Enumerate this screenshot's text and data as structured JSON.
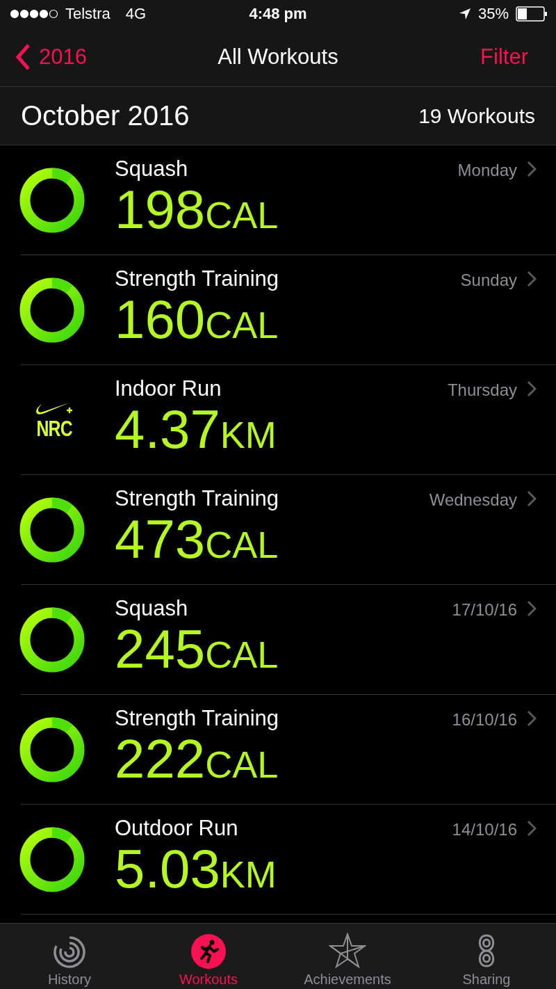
{
  "status_bar": {
    "carrier": "Telstra",
    "network": "4G",
    "time": "4:48 pm",
    "battery": "35%"
  },
  "nav": {
    "back": "2016",
    "title": "All Workouts",
    "action": "Filter"
  },
  "section": {
    "title": "October 2016",
    "count": "19 Workouts"
  },
  "workouts": [
    {
      "kind": "ring",
      "name": "Squash",
      "value": "198",
      "unit": "CAL",
      "date": "Monday"
    },
    {
      "kind": "ring",
      "name": "Strength Training",
      "value": "160",
      "unit": "CAL",
      "date": "Sunday"
    },
    {
      "kind": "nrc",
      "logo_text": "NRC",
      "name": "Indoor Run",
      "value": "4.37",
      "unit": "KM",
      "date": "Thursday"
    },
    {
      "kind": "ring",
      "name": "Strength Training",
      "value": "473",
      "unit": "CAL",
      "date": "Wednesday"
    },
    {
      "kind": "ring",
      "name": "Squash",
      "value": "245",
      "unit": "CAL",
      "date": "17/10/16"
    },
    {
      "kind": "ring",
      "name": "Strength Training",
      "value": "222",
      "unit": "CAL",
      "date": "16/10/16"
    },
    {
      "kind": "ring",
      "name": "Outdoor Run",
      "value": "5.03",
      "unit": "KM",
      "date": "14/10/16"
    }
  ],
  "tabs": [
    {
      "kind": "history",
      "label": "History",
      "selected": false
    },
    {
      "kind": "workouts",
      "label": "Workouts",
      "selected": true
    },
    {
      "kind": "achievements",
      "label": "Achievements",
      "selected": false
    },
    {
      "kind": "sharing",
      "label": "Sharing",
      "selected": false
    }
  ]
}
